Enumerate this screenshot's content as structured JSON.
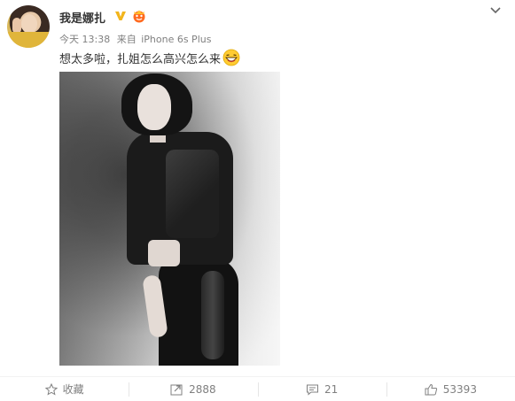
{
  "post": {
    "username": "我是娜扎",
    "meta": {
      "time": "今天 13:38",
      "source_prefix": "来自",
      "device": "iPhone 6s Plus"
    },
    "text": "想太多啦，扎姐怎么高兴怎么来",
    "emoji": "laughing-emoji"
  },
  "actions": {
    "favorite_label": "收藏",
    "repost_count": "2888",
    "comment_count": "21",
    "like_count": "53393"
  },
  "colors": {
    "verified_badge": "#f2b51d",
    "vip_badge": "#ff6a1f",
    "meta_text": "#808080",
    "main_text": "#333333"
  }
}
